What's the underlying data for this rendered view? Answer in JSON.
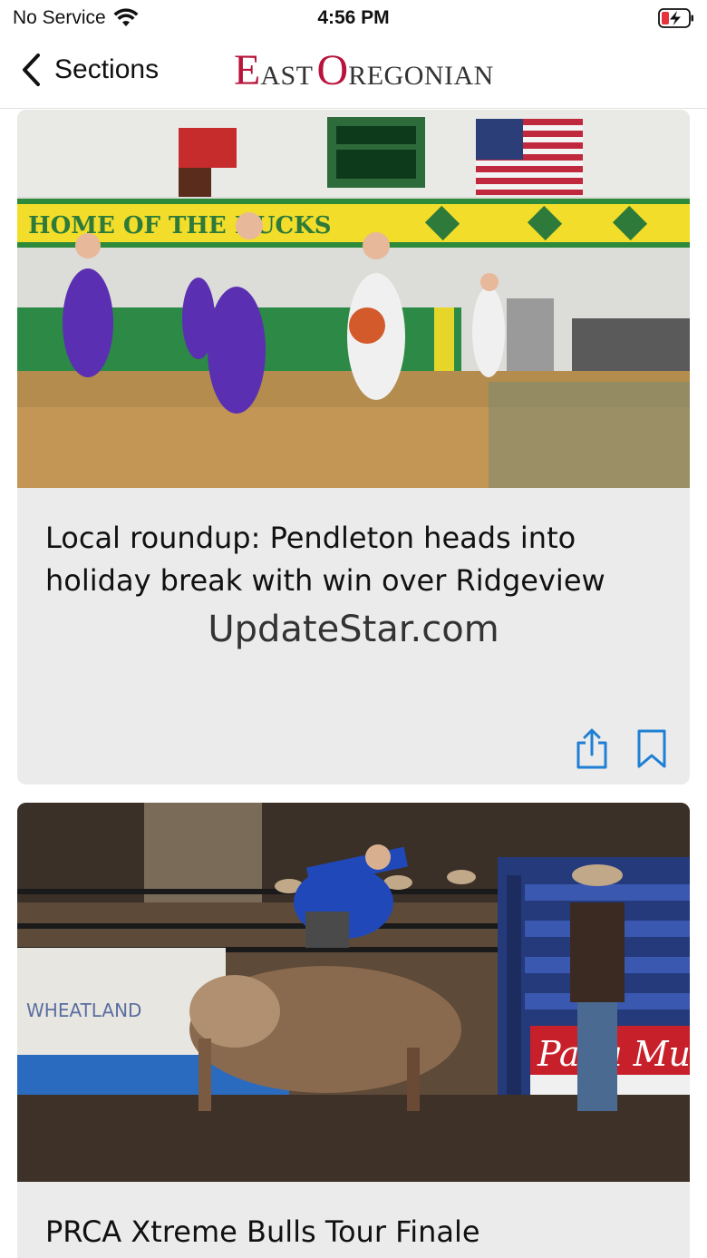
{
  "status_bar": {
    "carrier": "No Service",
    "time": "4:56 PM",
    "icons": [
      "wifi-icon",
      "battery-charging-icon"
    ],
    "battery_color": "#e5343d"
  },
  "nav": {
    "back_label": "Sections",
    "logo": {
      "first_letter_1": "E",
      "rest_1": "AST",
      "first_letter_2": "O",
      "rest_2": "REGONIAN"
    },
    "back_icon": "chevron-left-icon"
  },
  "colors": {
    "accent": "#1f7fd4",
    "logo_red": "#b8133b",
    "card_background": "#ebebeb"
  },
  "articles": [
    {
      "title": "Local roundup: Pendleton heads into holiday break with win over Ridgeview",
      "source": "UpdateStar.com",
      "image_alt": "girls basketball game",
      "actions": [
        "share-icon",
        "bookmark-icon"
      ]
    },
    {
      "title": "PRCA Xtreme Bulls Tour Finale",
      "image_alt": "bull riding at rodeo"
    }
  ]
}
